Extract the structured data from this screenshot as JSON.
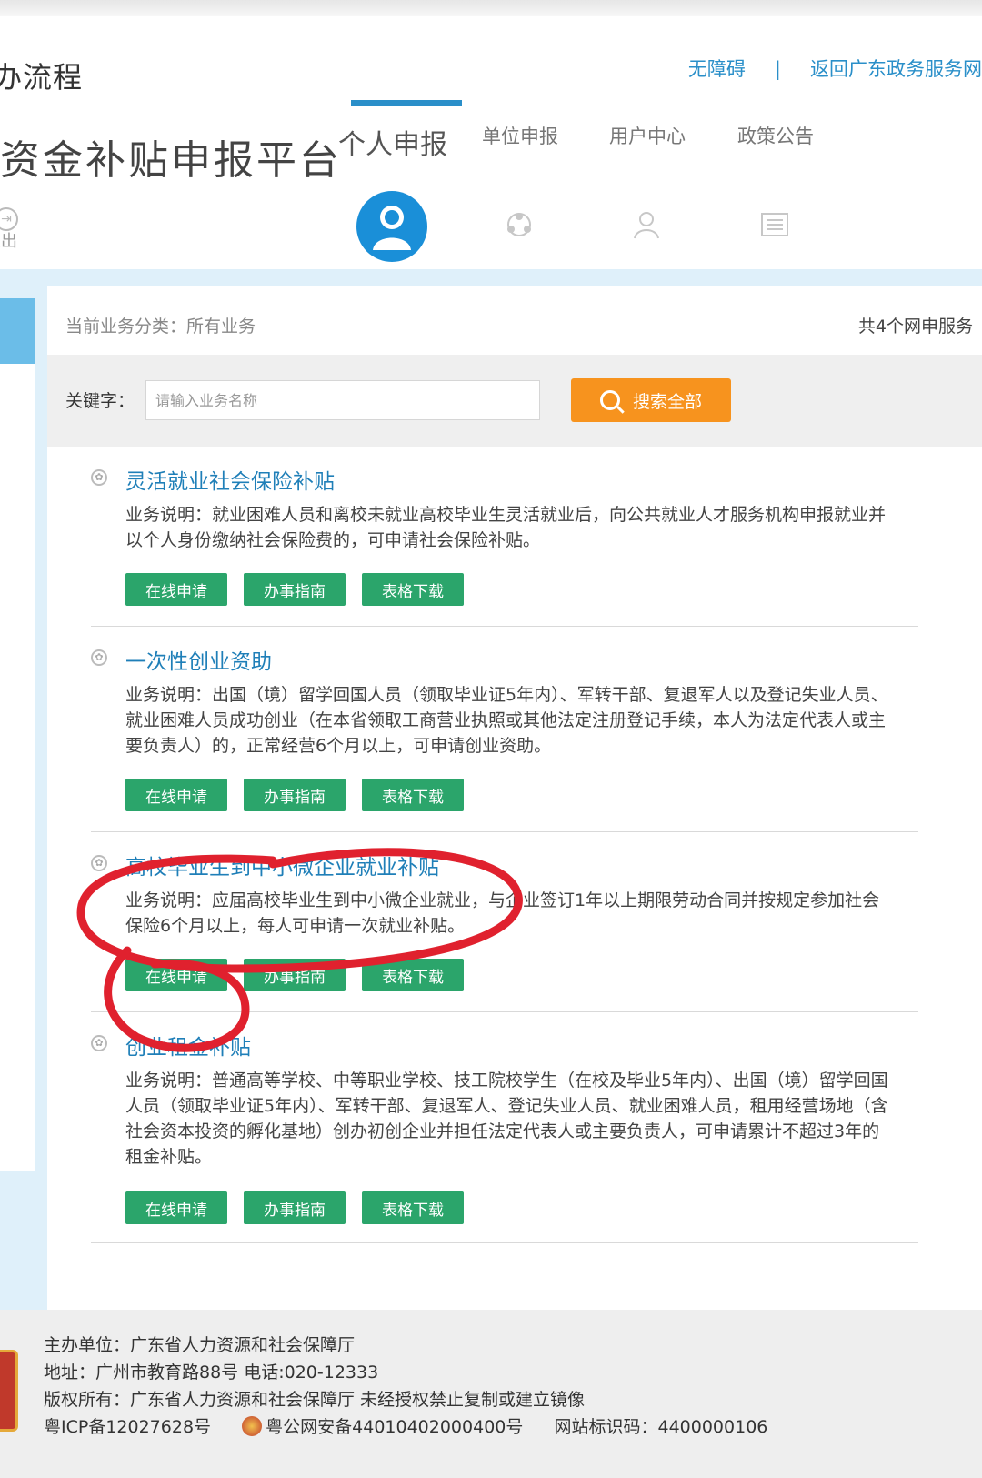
{
  "header": {
    "small_title": "办流程",
    "site_title": "资金补贴申报平台",
    "links": {
      "accessibility": "无障碍",
      "separator": "|",
      "back": "返回广东政务服务网"
    },
    "nav": [
      "个人申报",
      "单位申报",
      "用户中心",
      "政策公告"
    ],
    "logout": "退出"
  },
  "main": {
    "crumb": "当前业务分类：所有业务",
    "count": "共4个网申服务",
    "keyword_label": "关键字：",
    "search_placeholder": "请输入业务名称",
    "search_button": "搜索全部"
  },
  "buttons": {
    "apply": "在线申请",
    "guide": "办事指南",
    "download": "表格下载"
  },
  "services": [
    {
      "title": "灵活就业社会保险补贴",
      "desc": "业务说明：就业困难人员和离校未就业高校毕业生灵活就业后，向公共就业人才服务机构申报就业并以个人身份缴纳社会保险费的，可申请社会保险补贴。"
    },
    {
      "title": "一次性创业资助",
      "desc": "业务说明：出国（境）留学回国人员（领取毕业证5年内）、军转干部、复退军人以及登记失业人员、就业困难人员成功创业（在本省领取工商营业执照或其他法定注册登记手续，本人为法定代表人或主要负责人）的，正常经营6个月以上，可申请创业资助。"
    },
    {
      "title": "高校毕业生到中小微企业就业补贴",
      "desc": "业务说明：应届高校毕业生到中小微企业就业，与企业签订1年以上期限劳动合同并按规定参加社会保险6个月以上，每人可申请一次就业补贴。"
    },
    {
      "title": "创业租金补贴",
      "desc": "业务说明：普通高等学校、中等职业学校、技工院校学生（在校及毕业5年内）、出国（境）留学回国人员（领取毕业证5年内）、军转干部、复退军人、登记失业人员、就业困难人员，租用经营场地（含社会资本投资的孵化基地）创办初创企业并担任法定代表人或主要负责人，可申请累计不超过3年的租金补贴。"
    }
  ],
  "footer": {
    "sponsor": "主办单位：广东省人力资源和社会保障厅",
    "address": "地址：广州市教育路88号 电话:020-12333",
    "copyright": "版权所有：广东省人力资源和社会保障厅 未经授权禁止复制或建立镜像",
    "icp": "粤ICP备12027628号",
    "police": "粤公网安备44010402000400号",
    "site_code": "网站标识码：4400000106"
  },
  "colors": {
    "brand_blue": "#2a8fc9",
    "orange": "#f7931e",
    "green": "#2ba56b",
    "annotation_red": "#e0212e"
  }
}
